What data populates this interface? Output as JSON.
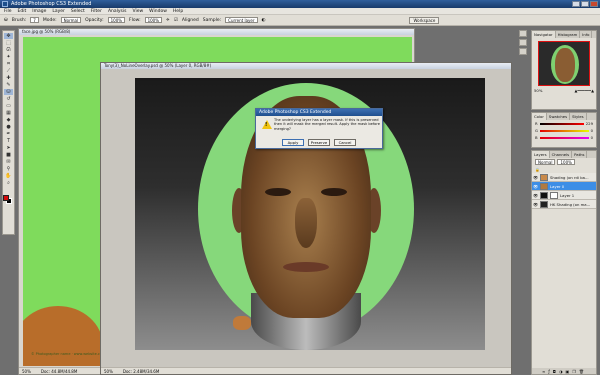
{
  "app": {
    "title": "Adobe Photoshop CS3 Extended"
  },
  "menu": [
    "File",
    "Edit",
    "Image",
    "Layer",
    "Select",
    "Filter",
    "Analysis",
    "View",
    "Window",
    "Help"
  ],
  "options": {
    "brush_label": "Brush:",
    "brush_size": "7",
    "mode_label": "Mode:",
    "mode_value": "Normal",
    "opacity_label": "Opacity:",
    "opacity_value": "100%",
    "flow_label": "Flow:",
    "flow_value": "100%",
    "aligned_label": "Aligned",
    "sample_label": "Sample:",
    "sample_value": "Current layer",
    "workspace_label": "Workspace"
  },
  "doc1": {
    "title": "face.jpg @ 50% (RGB/8)",
    "zoom": "50%",
    "size": "Doc: 44.8M/44.8M",
    "watermark": "© Photographer name · www.website.com"
  },
  "doc2": {
    "title": "Tony(3)_NoLineOverlay.psd @ 50% (Layer 0, RGB/8#)",
    "zoom": "50%",
    "size": "Doc: 2.48M/34.6M"
  },
  "dialog": {
    "title": "Adobe Photoshop CS3 Extended",
    "message": "The underlying layer has a layer mask. If this is preserved then it will mask the merged result. Apply the mask before merging?",
    "apply": "Apply",
    "preserve": "Preserve",
    "cancel": "Cancel"
  },
  "navigator": {
    "tabs": [
      "Navigator",
      "Histogram",
      "Info"
    ],
    "zoom": "50%"
  },
  "color": {
    "tabs": [
      "Color",
      "Swatches",
      "Styles"
    ],
    "r_label": "R",
    "r_value": "229",
    "g_label": "G",
    "g_value": "0",
    "b_label": "B",
    "b_value": "0"
  },
  "layers": {
    "tabs": [
      "Layers",
      "Channels",
      "Paths"
    ],
    "mode": "Normal",
    "opacity": "100%",
    "rows": [
      {
        "name": "Shading (on rdi ba..."
      },
      {
        "name": "Layer 0"
      },
      {
        "name": "Layer 1"
      },
      {
        "name": "HK Shading (on ma..."
      }
    ]
  },
  "colors": {
    "accent": "#3d8ee6",
    "green_bg": "#7fdb5c",
    "foreground": "#d30a0a",
    "background": "#000000"
  }
}
